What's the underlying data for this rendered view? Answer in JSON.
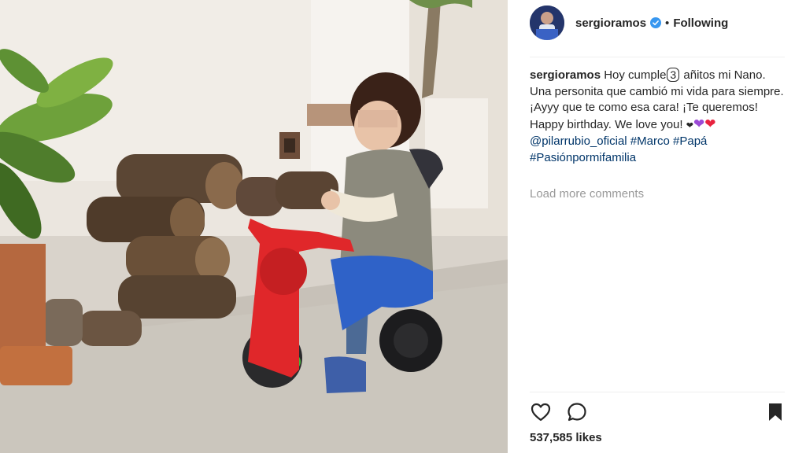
{
  "photo": {
    "description_icon": "photo-image"
  },
  "post": {
    "username": "sergioramos",
    "separator": "•",
    "follow_status": "Following",
    "caption": {
      "username": "sergioramos",
      "before_number": "Hoy cumple",
      "number": "3",
      "after_number": "añitos mi Nano. Una personita que cambió mi vida para siempre. ¡Ayyy que te como esa cara! ¡Te queremos!",
      "line2": "Happy birthday. We love you!",
      "mention": "@pilarrubio_oficial",
      "tag1": "#Marco",
      "tag2": "#Papá",
      "tag3": "#Pasiónpormifamilia"
    },
    "load_more": "Load more comments",
    "likes": "537,585 likes"
  },
  "colors": {
    "link": "#003569",
    "muted": "#999999",
    "verified": "#3897f0"
  }
}
